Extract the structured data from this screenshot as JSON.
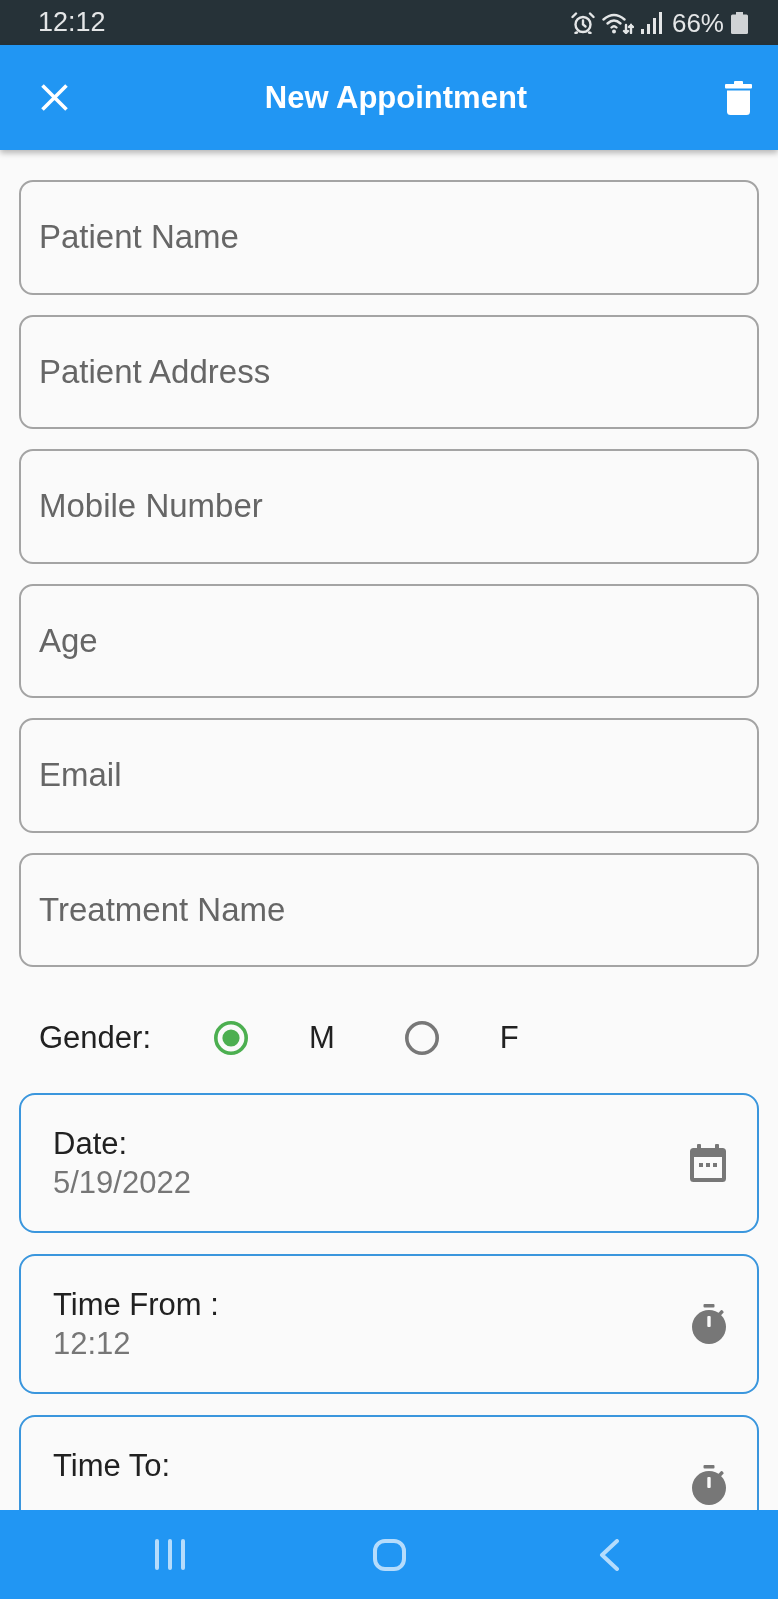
{
  "status_bar": {
    "time": "12:12",
    "battery": "66%"
  },
  "app_bar": {
    "title": "New Appointment"
  },
  "fields": [
    {
      "placeholder": "Patient Name"
    },
    {
      "placeholder": "Patient Address"
    },
    {
      "placeholder": "Mobile Number"
    },
    {
      "placeholder": "Age"
    },
    {
      "placeholder": "Email"
    },
    {
      "placeholder": "Treatment Name"
    }
  ],
  "gender": {
    "label": "Gender:",
    "options": [
      {
        "label": "M",
        "selected": true
      },
      {
        "label": "F",
        "selected": false
      }
    ]
  },
  "pickers": [
    {
      "kind": "date",
      "label": "Date:",
      "value": "5/19/2022"
    },
    {
      "kind": "time",
      "label": "Time From :",
      "value": "12:12"
    },
    {
      "kind": "time",
      "label": "Time To:"
    }
  ]
}
